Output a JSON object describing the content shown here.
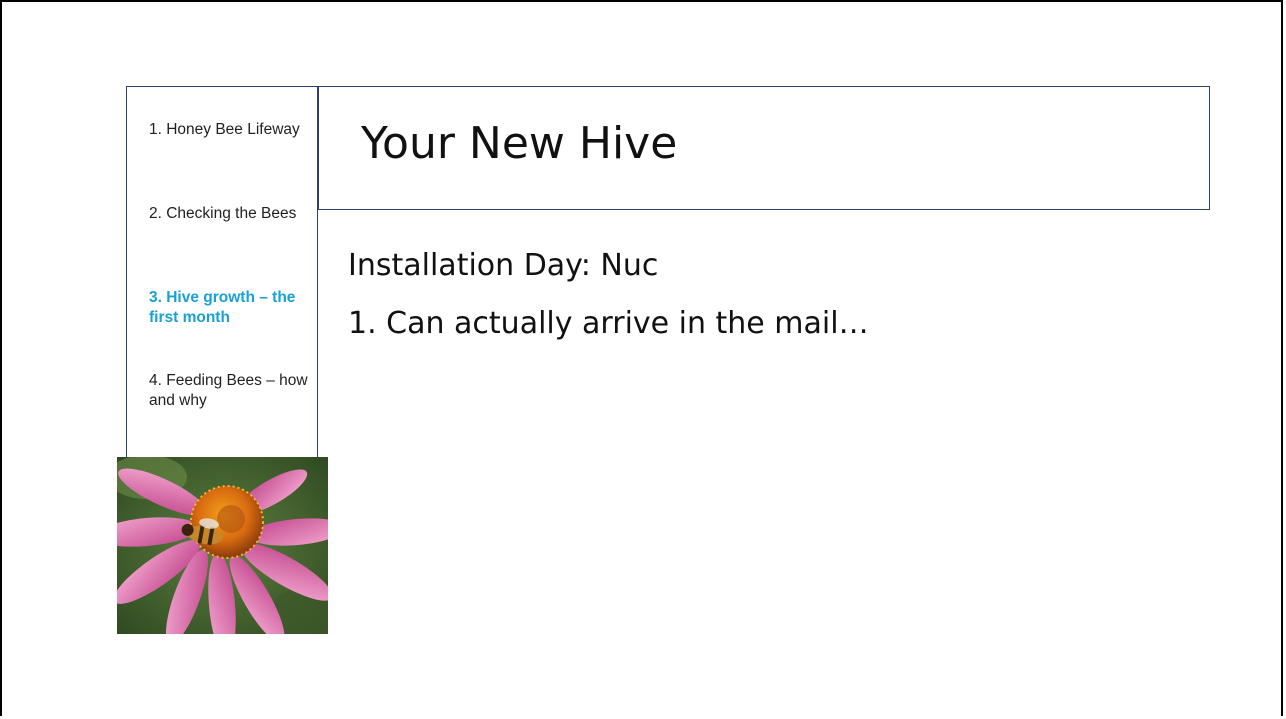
{
  "nav": {
    "items": [
      {
        "label": "1. Honey Bee Lifeway",
        "active": false
      },
      {
        "label": "2. Checking the Bees",
        "active": false
      },
      {
        "label": "3. Hive growth – the first month",
        "active": true
      },
      {
        "label": "4. Feeding Bees – how and why",
        "active": false
      }
    ]
  },
  "slide": {
    "title": "Your New Hive",
    "subtitle": "Installation Day: Nuc",
    "list": [
      "1.  Can actually arrive in the mail…"
    ]
  },
  "photo": {
    "subject": "bee-on-coneflower-photo"
  },
  "colors": {
    "active_nav": "#17a2d6",
    "border": "#2f3f6e"
  }
}
